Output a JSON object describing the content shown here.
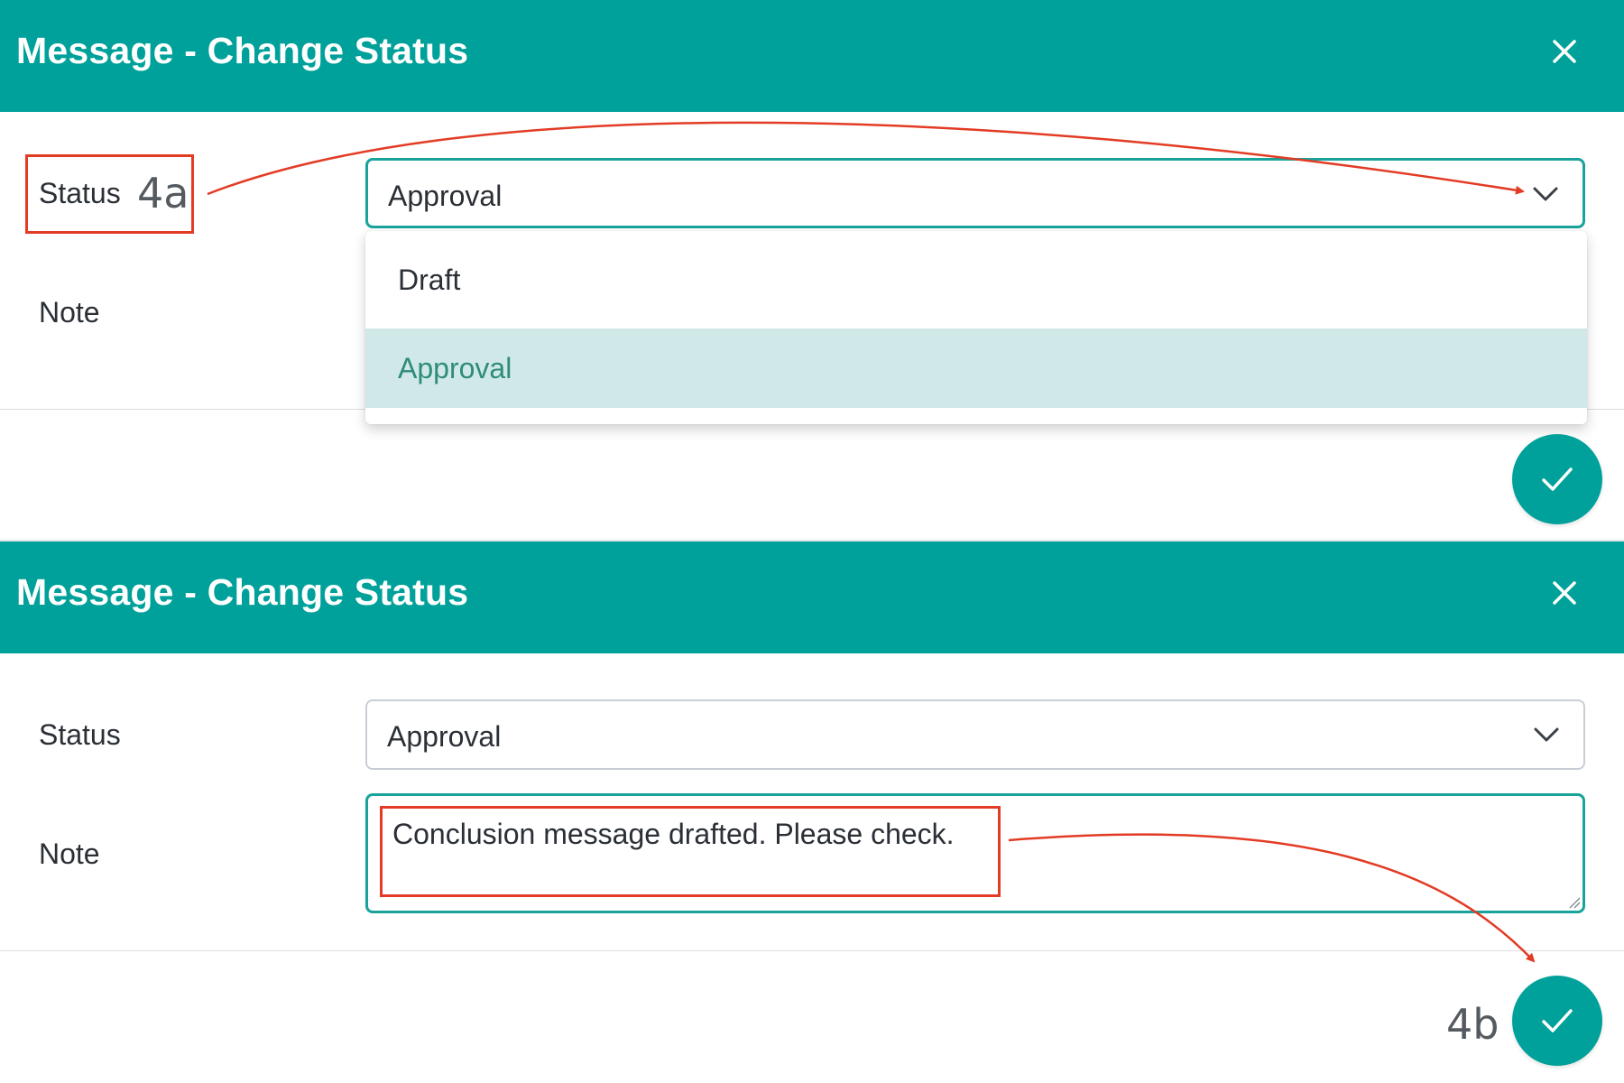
{
  "panel_top": {
    "title": "Message - Change Status",
    "status_label": "Status",
    "status_value": "Approval",
    "note_label": "Note",
    "dropdown_options": [
      "Draft",
      "Approval"
    ],
    "selected_option": "Approval",
    "annotation": "4a"
  },
  "panel_bottom": {
    "title": "Message - Change Status",
    "status_label": "Status",
    "status_value": "Approval",
    "note_label": "Note",
    "note_value": "Conclusion message drafted. Please check.",
    "annotation": "4b"
  },
  "colors": {
    "header": "#00a19a",
    "accent_border": "#1aa39b",
    "selected_option_bg": "#d0e9e8",
    "selected_option_text": "#2e8c79",
    "annotation_red": "#e33b24"
  },
  "icons": {
    "close": "close-icon",
    "chevron": "chevron-down-icon",
    "confirm": "check-icon"
  }
}
